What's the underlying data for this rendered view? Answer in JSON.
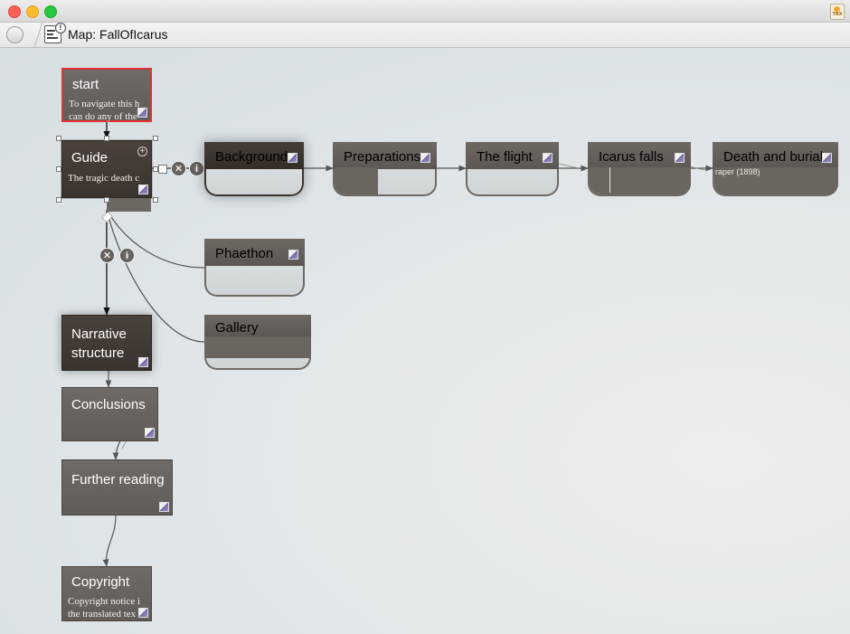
{
  "window": {
    "title_label": "Map: FallOfIcarus"
  },
  "app_icon": {
    "label": "TBX"
  },
  "colors": {
    "note_fill": "#65605c",
    "selected_fill": "#3f3731",
    "start_border": "#e0312f",
    "link_color": "#555555"
  },
  "notes": {
    "start": {
      "title": "start",
      "text": "To navigate this h",
      "text2": "can do any of the"
    },
    "guide": {
      "title": "Guide",
      "text": "The tragic death c"
    },
    "background": {
      "title": "Background"
    },
    "preparations": {
      "title": "Preparations"
    },
    "flight": {
      "title": "The flight"
    },
    "icarus_falls": {
      "title": "Icarus falls"
    },
    "death": {
      "title": "Death and burial",
      "text": "raper (1898)"
    },
    "phaethon": {
      "title": "Phaethon"
    },
    "gallery": {
      "title": "Gallery"
    },
    "narrative": {
      "title": "Narrative",
      "title2": "structure"
    },
    "conclusions": {
      "title": "Conclusions"
    },
    "further": {
      "title": "Further reading"
    },
    "copyright": {
      "title": "Copyright",
      "text": "Copyright notice i",
      "text2": "the translated tex"
    }
  },
  "link_controls": {
    "delete_icon": "close-x-icon",
    "info_icon": "info-icon",
    "info_label": "i",
    "delete_label": "✕",
    "add_label": "+"
  }
}
